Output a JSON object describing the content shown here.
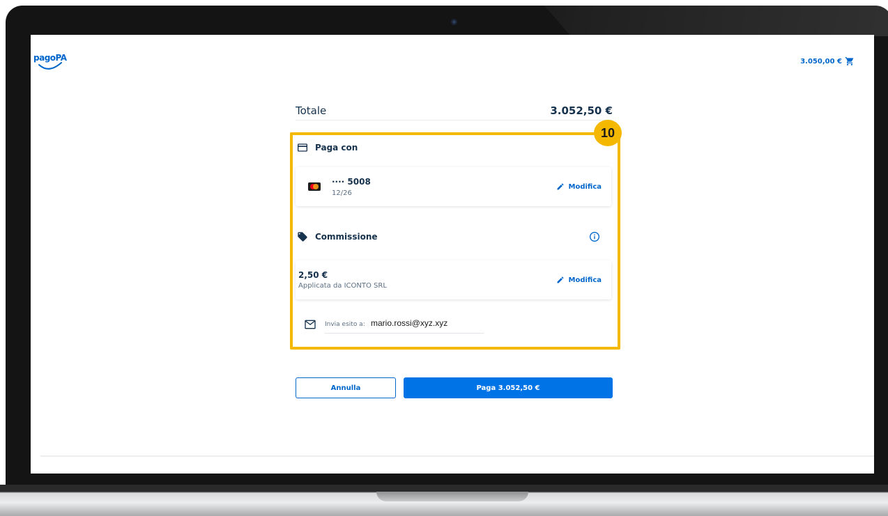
{
  "header": {
    "logo_text": "pagoPA",
    "cart_amount": "3.050,00 €",
    "cart_icon": "cart-icon"
  },
  "summary": {
    "total_label": "Totale",
    "total_amount": "3.052,50 €"
  },
  "annotation": {
    "step_number": "10",
    "highlight_color": "#f5b800"
  },
  "payment_method": {
    "section_title": "Paga con",
    "section_icon": "credit-card-icon",
    "card_brand_icon": "mastercard-icon",
    "card_number": "···· 5008",
    "card_expiry": "12/26",
    "edit_label": "Modifica"
  },
  "fee": {
    "section_title": "Commissione",
    "section_icon": "tag-icon",
    "info_icon": "info-icon",
    "amount": "2,50 €",
    "provider": "Applicata da ICONTO SRL",
    "edit_label": "Modifica"
  },
  "email": {
    "icon": "mail-icon",
    "label": "Invia esito a:",
    "value": "mario.rossi@xyz.xyz"
  },
  "actions": {
    "cancel_label": "Annulla",
    "pay_label": "Paga 3.052,50 €"
  },
  "colors": {
    "primary": "#0066cc",
    "primary_button": "#0073e6",
    "text_dark": "#17324d",
    "text_muted": "#5c6f82"
  }
}
